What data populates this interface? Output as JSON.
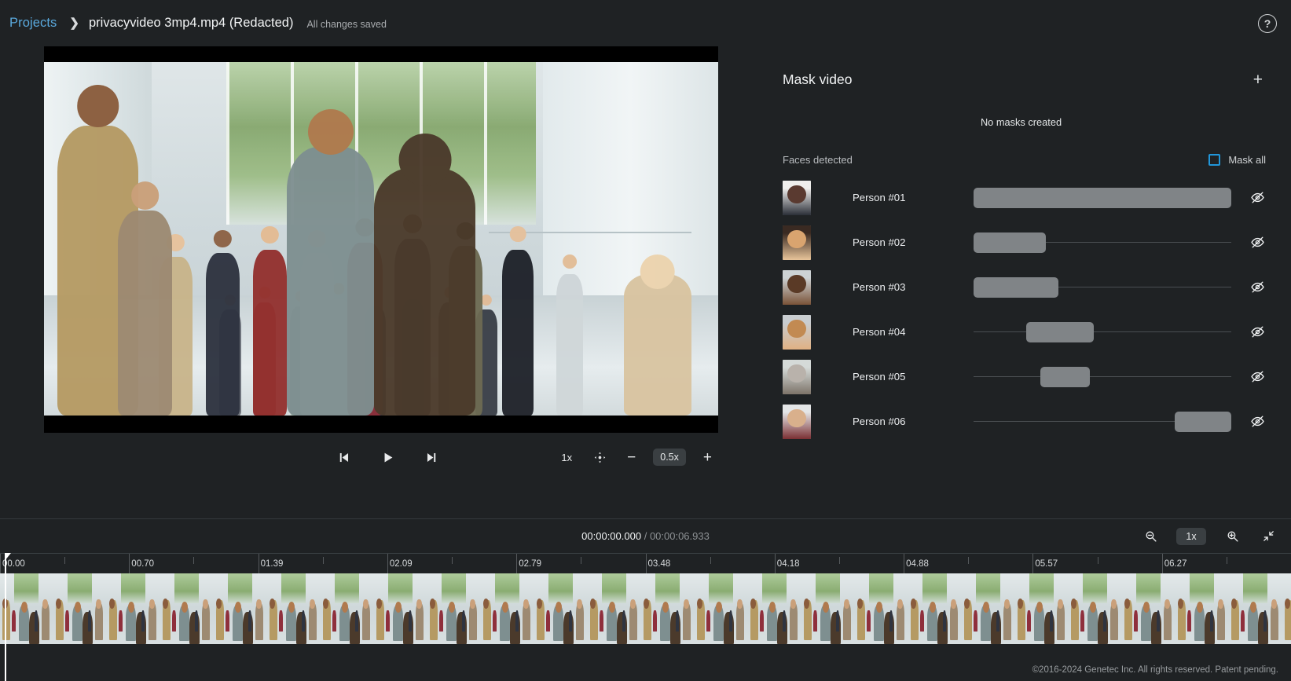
{
  "header": {
    "breadcrumb_root": "Projects",
    "breadcrumb_sep": "❯",
    "title": "privacyvideo 3mp4.mp4 (Redacted)",
    "save_state": "All changes saved",
    "help_label": "?"
  },
  "player": {
    "prev_frame_icon": "skip-previous-icon",
    "play_icon": "play-icon",
    "next_frame_icon": "skip-next-icon",
    "playback_rate": "1x",
    "fit_icon": "pan-fit-icon",
    "zoom_out_label": "−",
    "zoom_level": "0.5x",
    "zoom_in_label": "+"
  },
  "panel": {
    "title": "Mask video",
    "add_label": "+",
    "empty_state": "No masks created",
    "faces_label": "Faces detected",
    "mask_all_label": "Mask all",
    "mask_all_checked": false,
    "accent_color": "#2196d9",
    "faces": [
      {
        "name": "Person #01",
        "start_pct": 0,
        "width_pct": 100,
        "visible": false,
        "eye_icon": "eye-off-icon"
      },
      {
        "name": "Person #02",
        "start_pct": 0,
        "width_pct": 28,
        "visible": false,
        "eye_icon": "eye-off-icon"
      },
      {
        "name": "Person #03",
        "start_pct": 0,
        "width_pct": 33,
        "visible": false,
        "eye_icon": "eye-off-icon"
      },
      {
        "name": "Person #04",
        "start_pct": 20.5,
        "width_pct": 26,
        "visible": false,
        "eye_icon": "eye-off-icon"
      },
      {
        "name": "Person #05",
        "start_pct": 26,
        "width_pct": 19,
        "visible": false,
        "eye_icon": "eye-off-icon"
      },
      {
        "name": "Person #06",
        "start_pct": 78,
        "width_pct": 22,
        "visible": false,
        "eye_icon": "eye-off-icon"
      }
    ]
  },
  "timeline": {
    "current_time": "00:00:00.000",
    "separator": "/",
    "total_time": "00:00:06.933",
    "zoom_out_icon": "zoom-out-icon",
    "zoom_level": "1x",
    "zoom_in_icon": "zoom-in-icon",
    "fit_icon": "collapse-icon",
    "playhead_position_pct": 0.35,
    "ruler_labels": [
      "00.00",
      "00.70",
      "01.39",
      "02.09",
      "02.79",
      "03.48",
      "04.18",
      "04.88",
      "05.57",
      "06.27"
    ]
  },
  "footer": {
    "copyright": "©2016-2024 Genetec Inc. All rights reserved. Patent pending."
  }
}
